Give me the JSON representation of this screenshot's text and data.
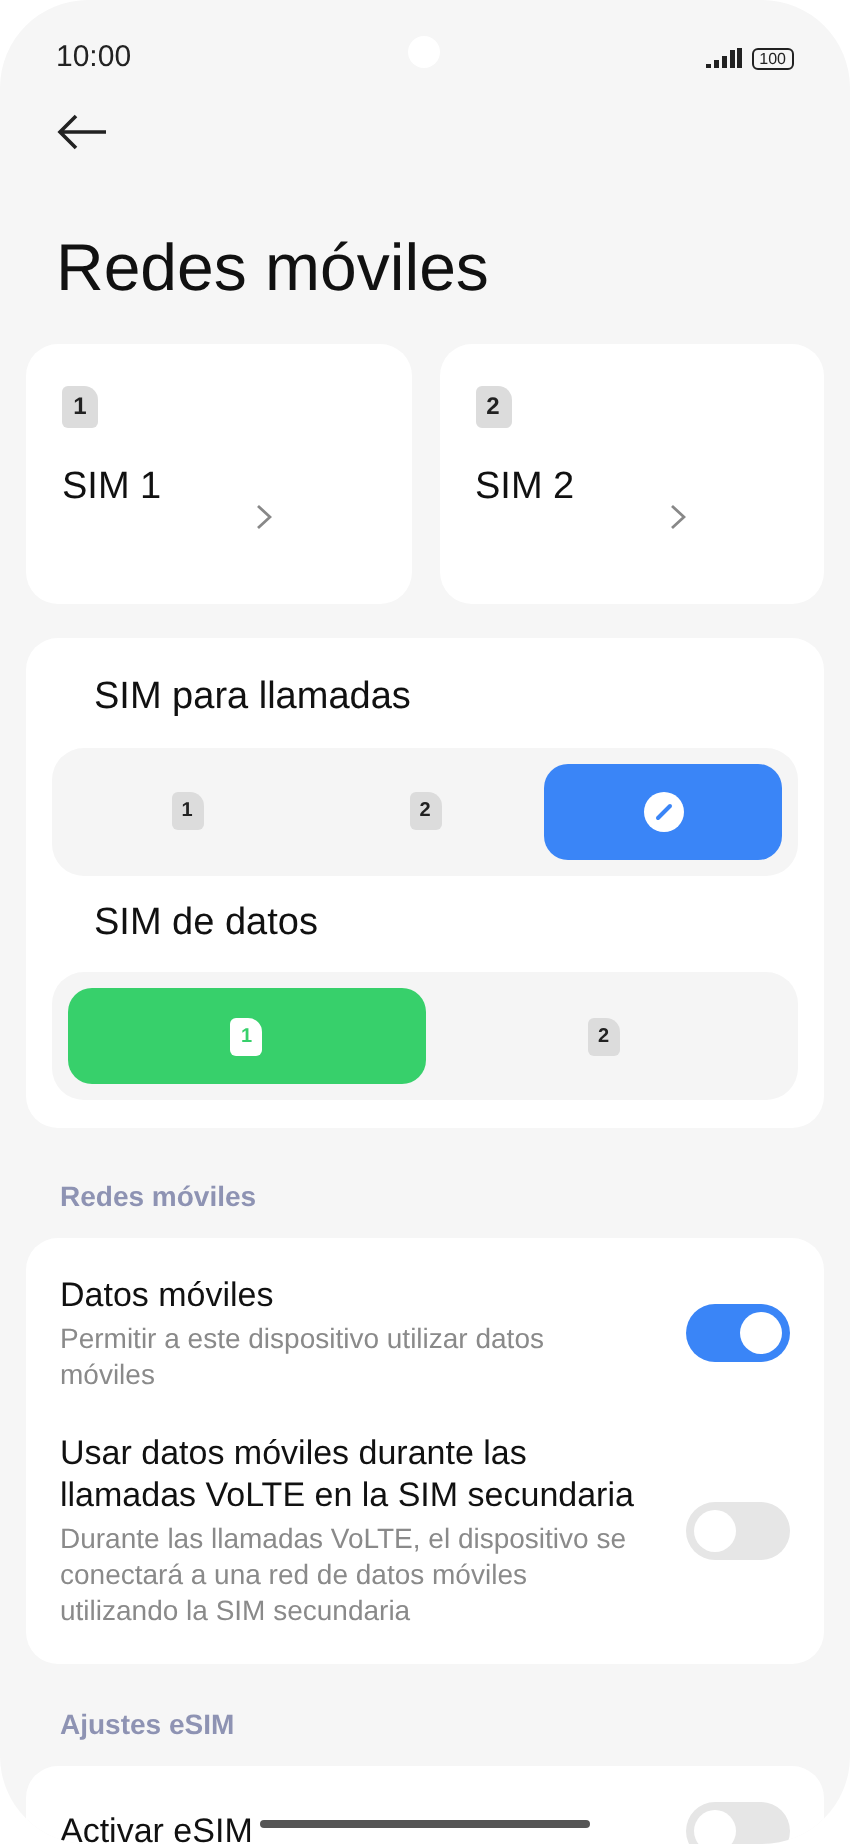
{
  "status_bar": {
    "time": "10:00",
    "battery": "100"
  },
  "title": "Redes móviles",
  "sim_cards": [
    {
      "number": "1",
      "label": "SIM 1"
    },
    {
      "number": "2",
      "label": "SIM 2"
    }
  ],
  "sim_groups": [
    {
      "kind": "calls",
      "title": "SIM para llamadas",
      "options": [
        {
          "kind": "sim",
          "number": "1",
          "selected": false
        },
        {
          "kind": "sim",
          "number": "2",
          "selected": false
        },
        {
          "kind": "ask",
          "selected": true
        }
      ]
    },
    {
      "kind": "data",
      "title": "SIM de datos",
      "options": [
        {
          "kind": "sim",
          "number": "1",
          "selected": true
        },
        {
          "kind": "sim",
          "number": "2",
          "selected": false
        }
      ]
    }
  ],
  "sections": [
    {
      "header": "Redes móviles",
      "items": [
        {
          "title": "Datos móviles",
          "subtitle": "Permitir a este dispositivo utilizar datos móviles",
          "on": true
        },
        {
          "title": "Usar datos móviles durante las llamadas VoLTE en la SIM secundaria",
          "subtitle": "Durante las llamadas VoLTE, el dispositivo se conectará a una red de datos móviles utilizando la SIM secundaria",
          "on": false
        }
      ]
    },
    {
      "header": "Ajustes eSIM",
      "items": [
        {
          "title": "Activar eSIM",
          "on": false
        }
      ]
    }
  ]
}
